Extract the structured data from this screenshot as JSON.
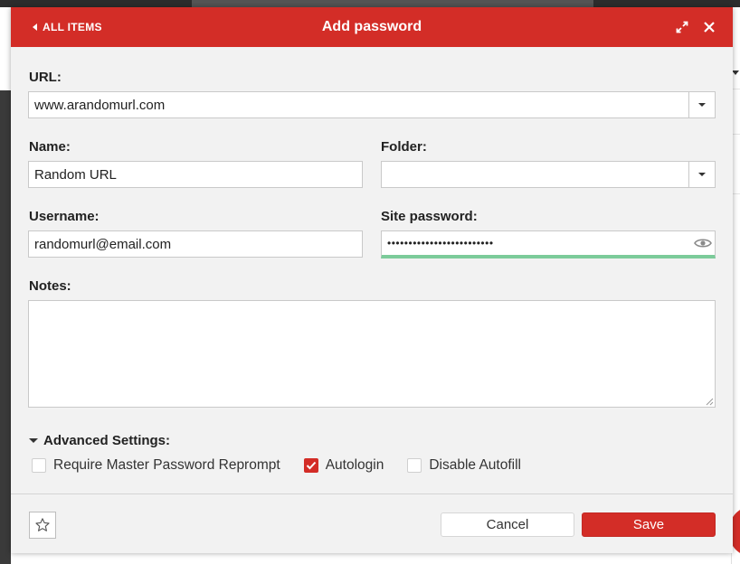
{
  "header": {
    "back_label": "ALL ITEMS",
    "title": "Add password"
  },
  "form": {
    "url_label": "URL:",
    "url_value": "www.arandomurl.com",
    "name_label": "Name:",
    "name_value": "Random URL",
    "folder_label": "Folder:",
    "folder_value": "",
    "username_label": "Username:",
    "username_value": "randomurl@email.com",
    "password_label": "Site password:",
    "password_masked": "•••••••••••••••••••••••••",
    "notes_label": "Notes:",
    "notes_value": ""
  },
  "advanced": {
    "label": "Advanced Settings:",
    "options": [
      {
        "label": "Require Master Password Reprompt",
        "checked": false
      },
      {
        "label": "Autologin",
        "checked": true
      },
      {
        "label": "Disable Autofill",
        "checked": false
      }
    ]
  },
  "footer": {
    "cancel_label": "Cancel",
    "save_label": "Save"
  },
  "colors": {
    "accent": "#d32d27",
    "password_strength": "#7ccb9a",
    "dialog_bg": "#f2f2f2"
  },
  "icons": {
    "back": "caret-left-icon",
    "expand": "expand-icon",
    "close": "close-icon",
    "dropdown": "chevron-down-icon",
    "reveal": "eye-icon",
    "favorite": "star-icon"
  }
}
